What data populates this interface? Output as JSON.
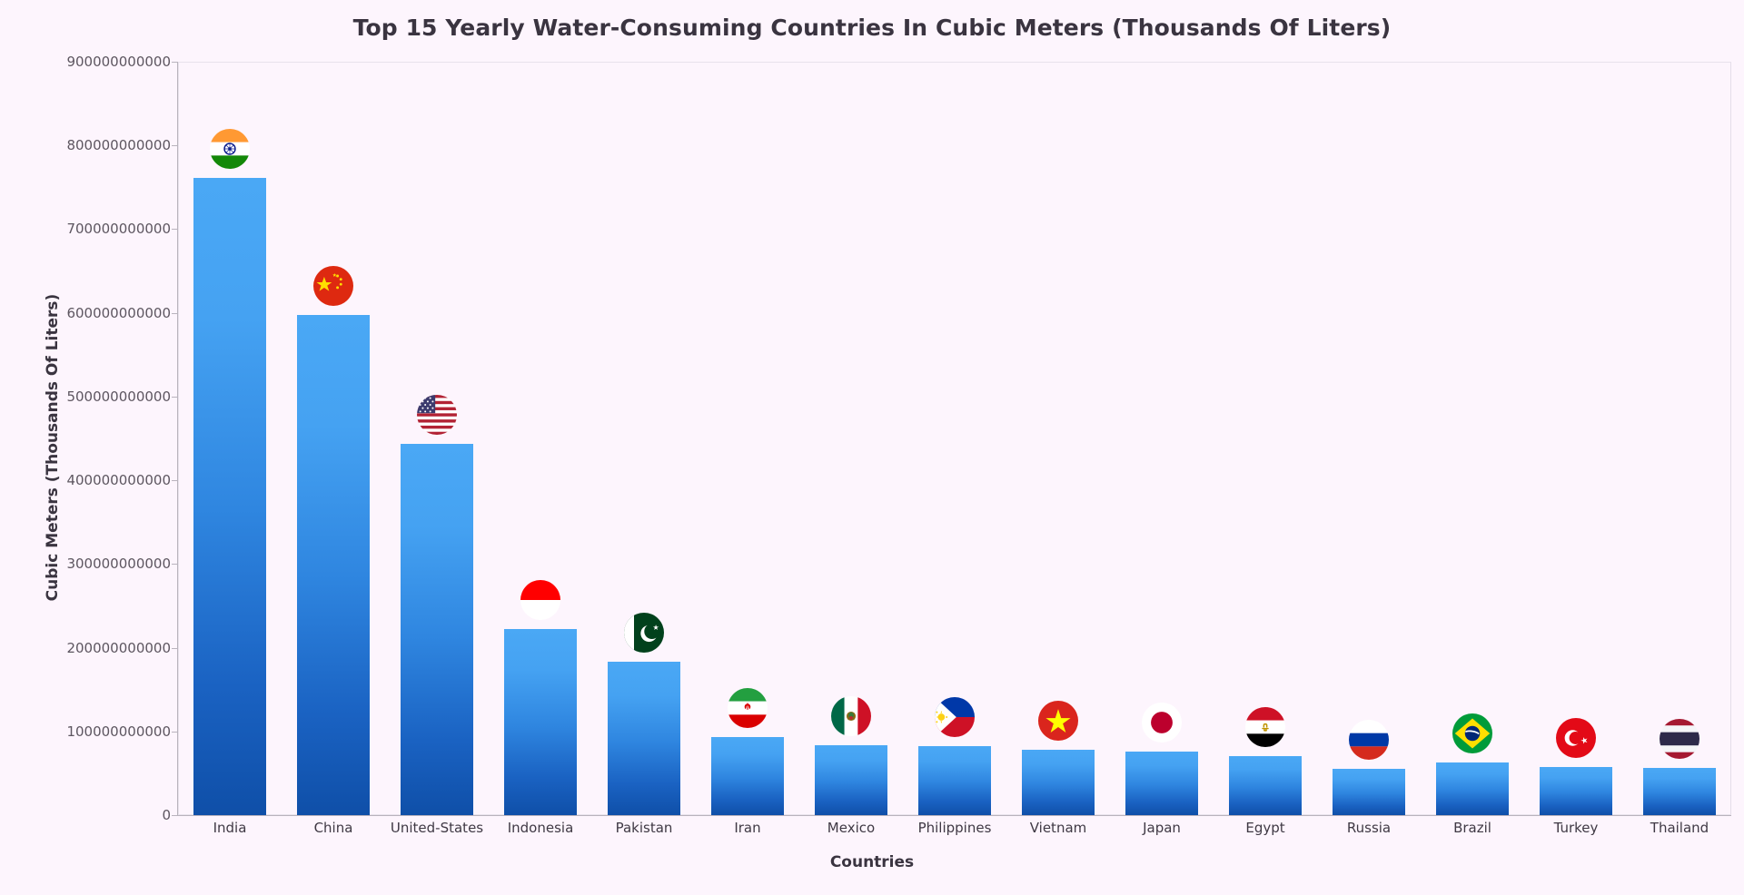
{
  "chart_data": {
    "type": "bar",
    "title": "Top 15 Yearly Water-Consuming Countries In Cubic Meters (Thousands Of Liters)",
    "xlabel": "Countries",
    "ylabel": "Cubic Meters (Thousands Of Liters)",
    "categories": [
      "India",
      "China",
      "United-States",
      "Indonesia",
      "Pakistan",
      "Iran",
      "Mexico",
      "Philippines",
      "Vietnam",
      "Japan",
      "Egypt",
      "Russia",
      "Brazil",
      "Turkey",
      "Thailand"
    ],
    "values": [
      761000000000,
      598000000000,
      444000000000,
      222000000000,
      183000000000,
      93000000000,
      84000000000,
      82000000000,
      78000000000,
      76000000000,
      70000000000,
      55000000000,
      63000000000,
      57000000000,
      56000000000
    ],
    "ylim": [
      0,
      900000000000
    ],
    "xlim_note": "categorical",
    "grid": false,
    "legend": "none",
    "y_ticks": [
      {
        "value": 0,
        "label": "0"
      },
      {
        "value": 100000000000,
        "label": "100000000000"
      },
      {
        "value": 200000000000,
        "label": "200000000000"
      },
      {
        "value": 300000000000,
        "label": "300000000000"
      },
      {
        "value": 400000000000,
        "label": "400000000000"
      },
      {
        "value": 500000000000,
        "label": "500000000000"
      },
      {
        "value": 600000000000,
        "label": "600000000000"
      },
      {
        "value": 700000000000,
        "label": "700000000000"
      },
      {
        "value": 800000000000,
        "label": "800000000000"
      },
      {
        "value": 900000000000,
        "label": "900000000000"
      }
    ],
    "markers": [
      {
        "country": "India",
        "icon": "flag-india-icon"
      },
      {
        "country": "China",
        "icon": "flag-china-icon"
      },
      {
        "country": "United-States",
        "icon": "flag-united-states-icon"
      },
      {
        "country": "Indonesia",
        "icon": "flag-indonesia-icon"
      },
      {
        "country": "Pakistan",
        "icon": "flag-pakistan-icon"
      },
      {
        "country": "Iran",
        "icon": "flag-iran-icon"
      },
      {
        "country": "Mexico",
        "icon": "flag-mexico-icon"
      },
      {
        "country": "Philippines",
        "icon": "flag-philippines-icon"
      },
      {
        "country": "Vietnam",
        "icon": "flag-vietnam-icon"
      },
      {
        "country": "Japan",
        "icon": "flag-japan-icon"
      },
      {
        "country": "Egypt",
        "icon": "flag-egypt-icon"
      },
      {
        "country": "Russia",
        "icon": "flag-russia-icon"
      },
      {
        "country": "Brazil",
        "icon": "flag-brazil-icon"
      },
      {
        "country": "Turkey",
        "icon": "flag-turkey-icon"
      },
      {
        "country": "Thailand",
        "icon": "flag-thailand-icon"
      }
    ],
    "colors": {
      "background": "#fdf5fd",
      "bar_top": "#4aa8f5",
      "bar_bottom": "#0f4fa8",
      "axis_line": "#b9b3bd",
      "title_text": "#3a3440",
      "tick_text": "#5d5660"
    }
  }
}
